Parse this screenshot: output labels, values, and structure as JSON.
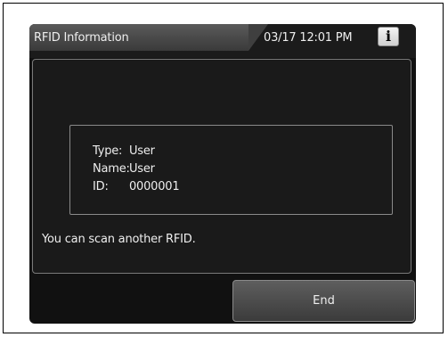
{
  "header": {
    "title": "RFID Information",
    "datetime": "03/17 12:01 PM",
    "info_icon_glyph": "i",
    "info_icon": "info-icon"
  },
  "details": {
    "type_label": "Type:",
    "type_value": "User",
    "name_label": "Name:",
    "name_value": "User",
    "id_label": "ID:",
    "id_value": "0000001"
  },
  "message": "You can scan another RFID.",
  "footer": {
    "end_label": "End"
  },
  "colors": {
    "screen_background": "#111111",
    "title_tab": "#4a4a4a",
    "text": "#eeeeee",
    "border": "#8a8a8a"
  }
}
